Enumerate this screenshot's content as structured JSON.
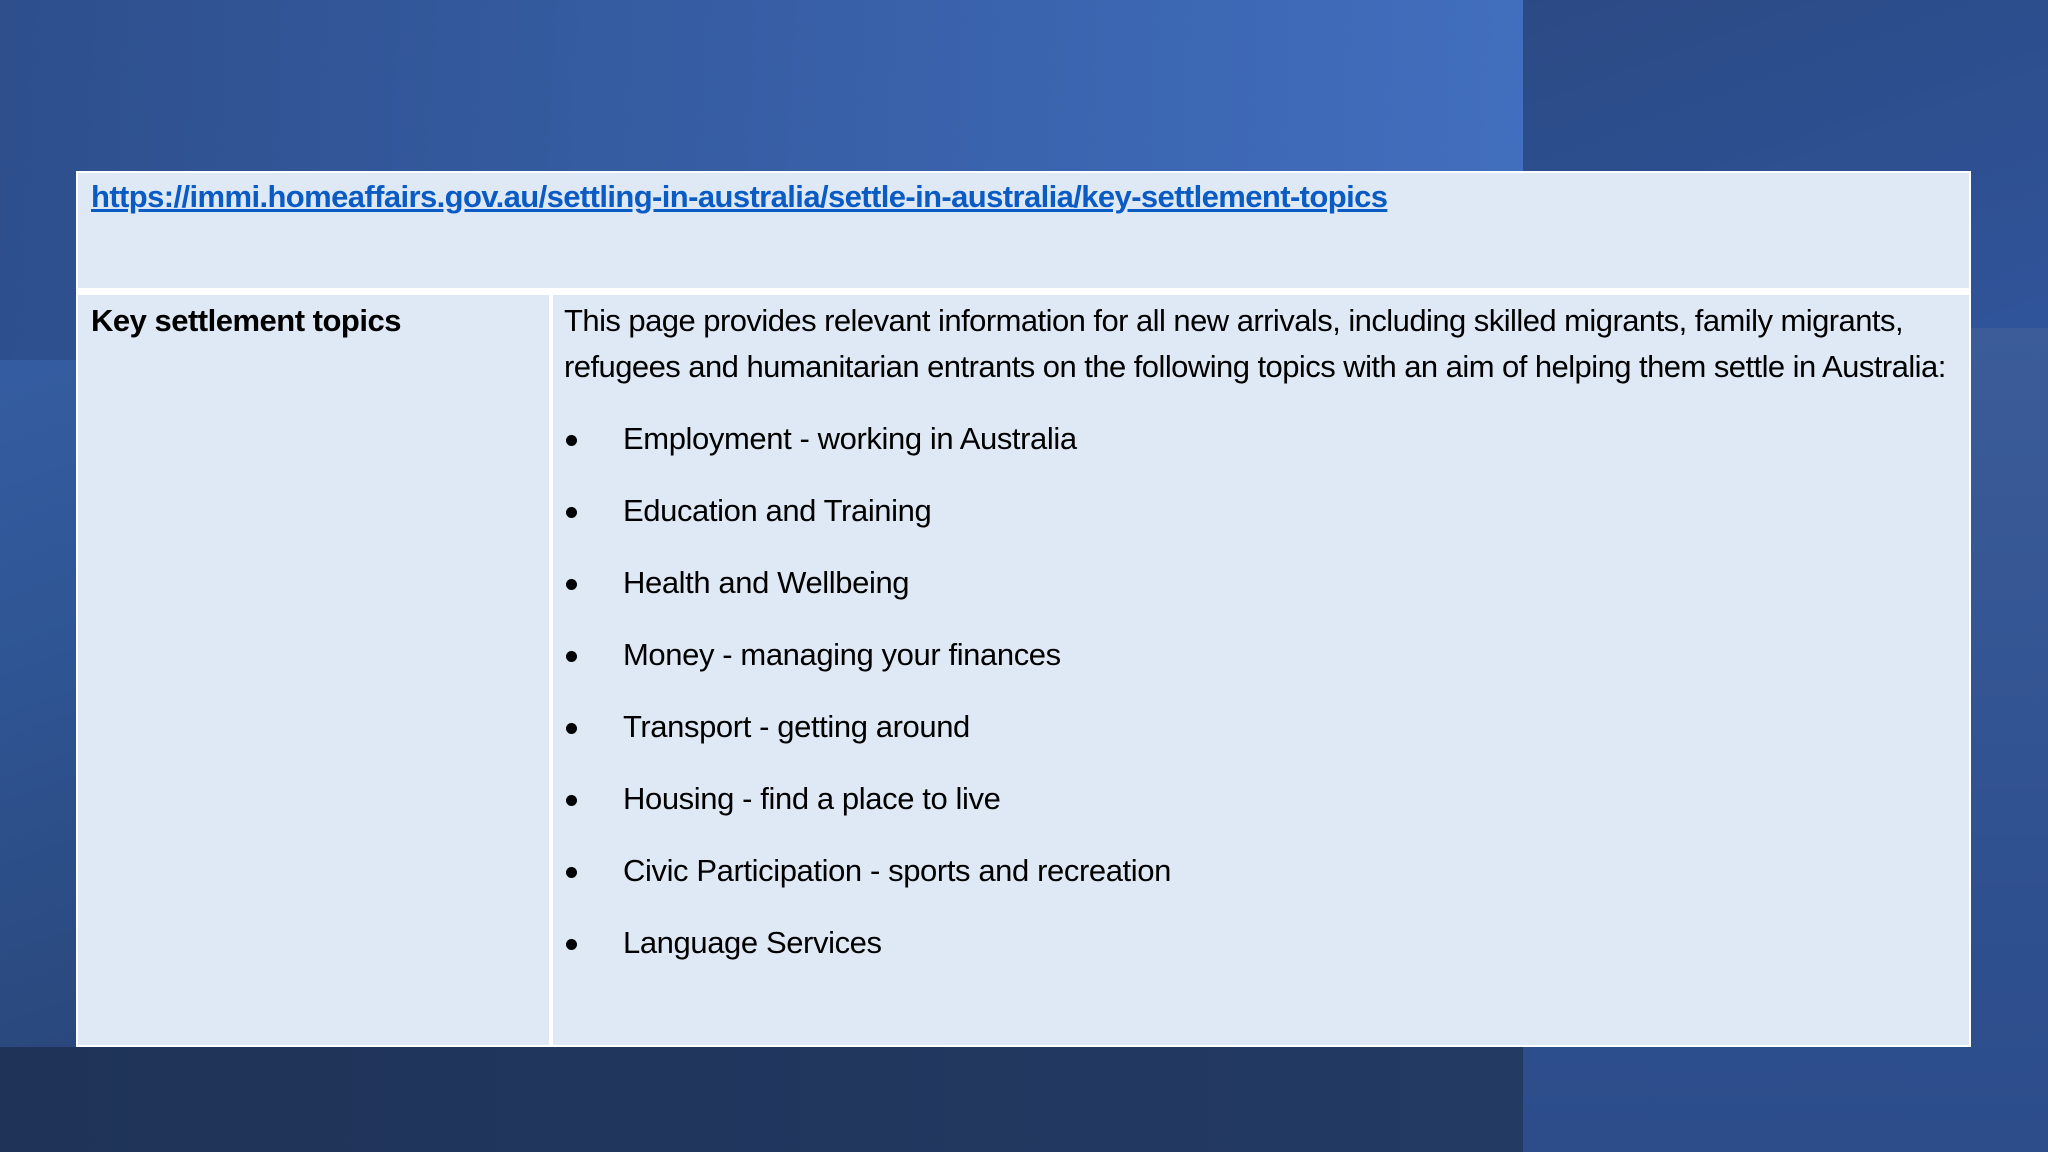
{
  "slide": {
    "url_link": "https://immi.homeaffairs.gov.au/settling-in-australia/settle-in-australia/key-settlement-topics",
    "row_label": "Key settlement topics",
    "intro": "This page provides relevant information for all new arrivals, including skilled migrants, family migrants, refugees and humanitarian entrants on the following topics with an aim of helping them settle in Australia:",
    "topics": [
      "Employment - working in Australia",
      "Education and Training",
      "Health and Wellbeing",
      "Money - managing your finances",
      "Transport - getting around",
      "Housing - find a place to live",
      "Civic Participation - sports and recreation",
      "Language Services"
    ]
  },
  "colors": {
    "link": "#0a5bc4",
    "cell_bg": "#dfe9f5",
    "background": "#2f5594"
  }
}
